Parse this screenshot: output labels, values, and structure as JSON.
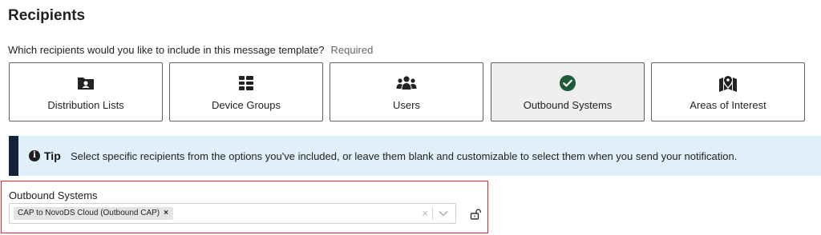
{
  "header": {
    "title": "Recipients"
  },
  "question": {
    "text": "Which recipients would you like to include in this message template?",
    "required": "Required"
  },
  "cards": [
    {
      "label": "Distribution Lists",
      "icon": "folder-person-icon",
      "selected": false
    },
    {
      "label": "Device Groups",
      "icon": "grid-list-icon",
      "selected": false
    },
    {
      "label": "Users",
      "icon": "users-icon",
      "selected": false
    },
    {
      "label": "Outbound Systems",
      "icon": "check-circle-icon",
      "selected": true
    },
    {
      "label": "Areas of Interest",
      "icon": "map-pin-icon",
      "selected": false
    }
  ],
  "tip": {
    "label": "Tip",
    "text": "Select specific recipients from the options you've included, or leave them blank and customizable to select them when you send your notification."
  },
  "outbound_field": {
    "label": "Outbound Systems",
    "chips": [
      {
        "text": "CAP to NovoDS Cloud (Outbound CAP)",
        "remove": "×"
      }
    ],
    "clear": "×"
  },
  "colors": {
    "tip_background": "#dff0fb",
    "tip_bar": "#142337",
    "selected_card": "#efefef",
    "check": "#1c5a3a",
    "error_border": "#d9272e"
  }
}
